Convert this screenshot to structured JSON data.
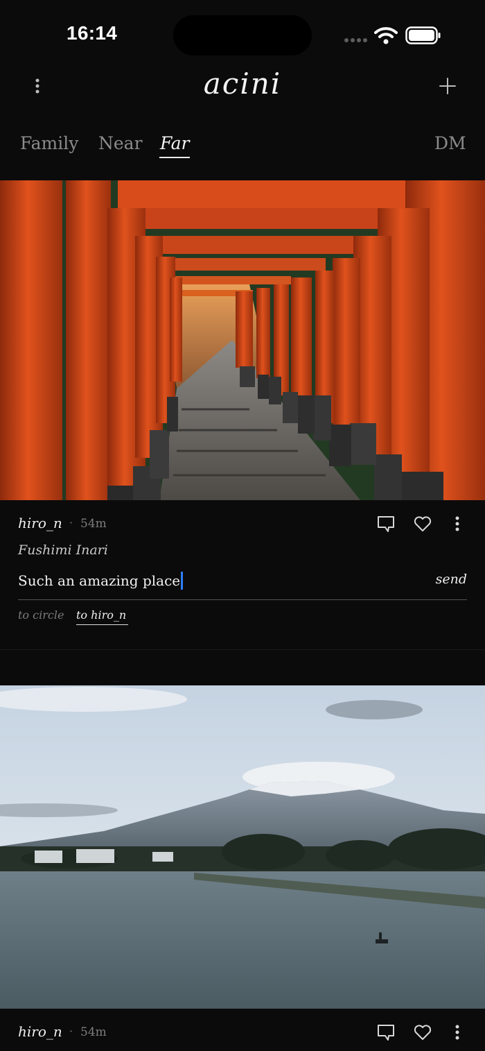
{
  "status_bar": {
    "time": "16:14"
  },
  "header": {
    "title": "acini",
    "menu_icon": "vertical-ellipsis-icon",
    "add_icon": "plus-icon"
  },
  "tabs": [
    {
      "label": "Family",
      "active": false
    },
    {
      "label": "Near",
      "active": false
    },
    {
      "label": "Far",
      "active": true
    },
    {
      "label": "DM",
      "active": false
    }
  ],
  "posts": [
    {
      "author": "hiro_n",
      "separator": "·",
      "time": "54m",
      "location": "Fushimi Inari",
      "image": "torii-gates-photo",
      "reply": {
        "value": "Such an amazing place",
        "send_label": "send",
        "audience_options": [
          "to circle",
          "to hiro_n"
        ],
        "selected_audience": "to hiro_n"
      }
    },
    {
      "author": "hiro_n",
      "separator": "·",
      "time": "54m",
      "image": "mount-fuji-lake-photo"
    }
  ],
  "colors": {
    "background": "#0b0b0b",
    "text": "#f2f2f2",
    "muted": "#8b8b8b",
    "caret": "#2f7df6",
    "torii": "#d9461a"
  }
}
